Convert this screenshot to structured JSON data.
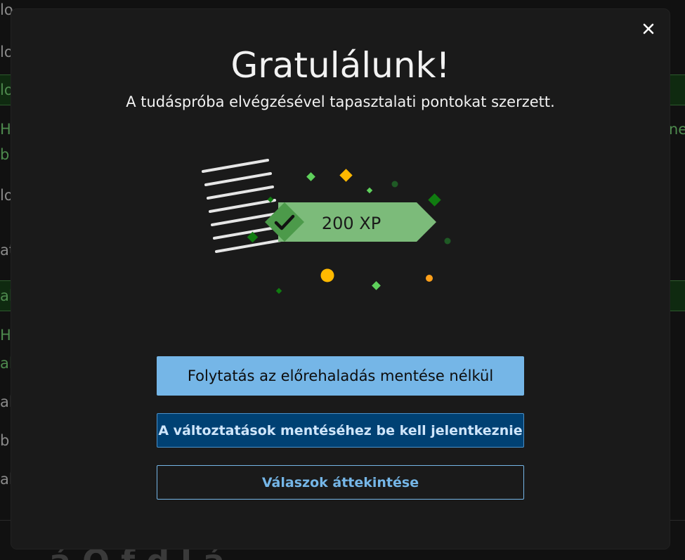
{
  "modal": {
    "title": "Gratulálunk!",
    "subtitle": "A tudáspróba elvégzésével tapasztalati pontokat szerzett.",
    "close_label": "✕",
    "xp_badge": "200 XP",
    "buttons": {
      "continue_without_saving": "Folytatás az előrehaladás mentése nélkül",
      "sign_in_to_save": "A változtatások mentéséhez be kell jelentkeznie",
      "review_answers": "Válaszok áttekintése"
    }
  },
  "background": {
    "visible_fragments": [
      "lo",
      "lo",
      "lo",
      "H",
      "bl",
      "lo",
      "at",
      "al",
      "H",
      "al",
      "al",
      "b",
      "al",
      "ne",
      "nem"
    ]
  },
  "colors": {
    "modal_bg": "#1a1a1a",
    "primary_button": "#75b6e7",
    "secondary_button": "#004173",
    "xp_badge": "#7cbb7a",
    "check_diamond": "#4c9a4a",
    "accent_yellow": "#ffb900"
  },
  "icons": {
    "close": "close-icon",
    "checkmark": "checkmark-icon",
    "document": "document-icon"
  }
}
